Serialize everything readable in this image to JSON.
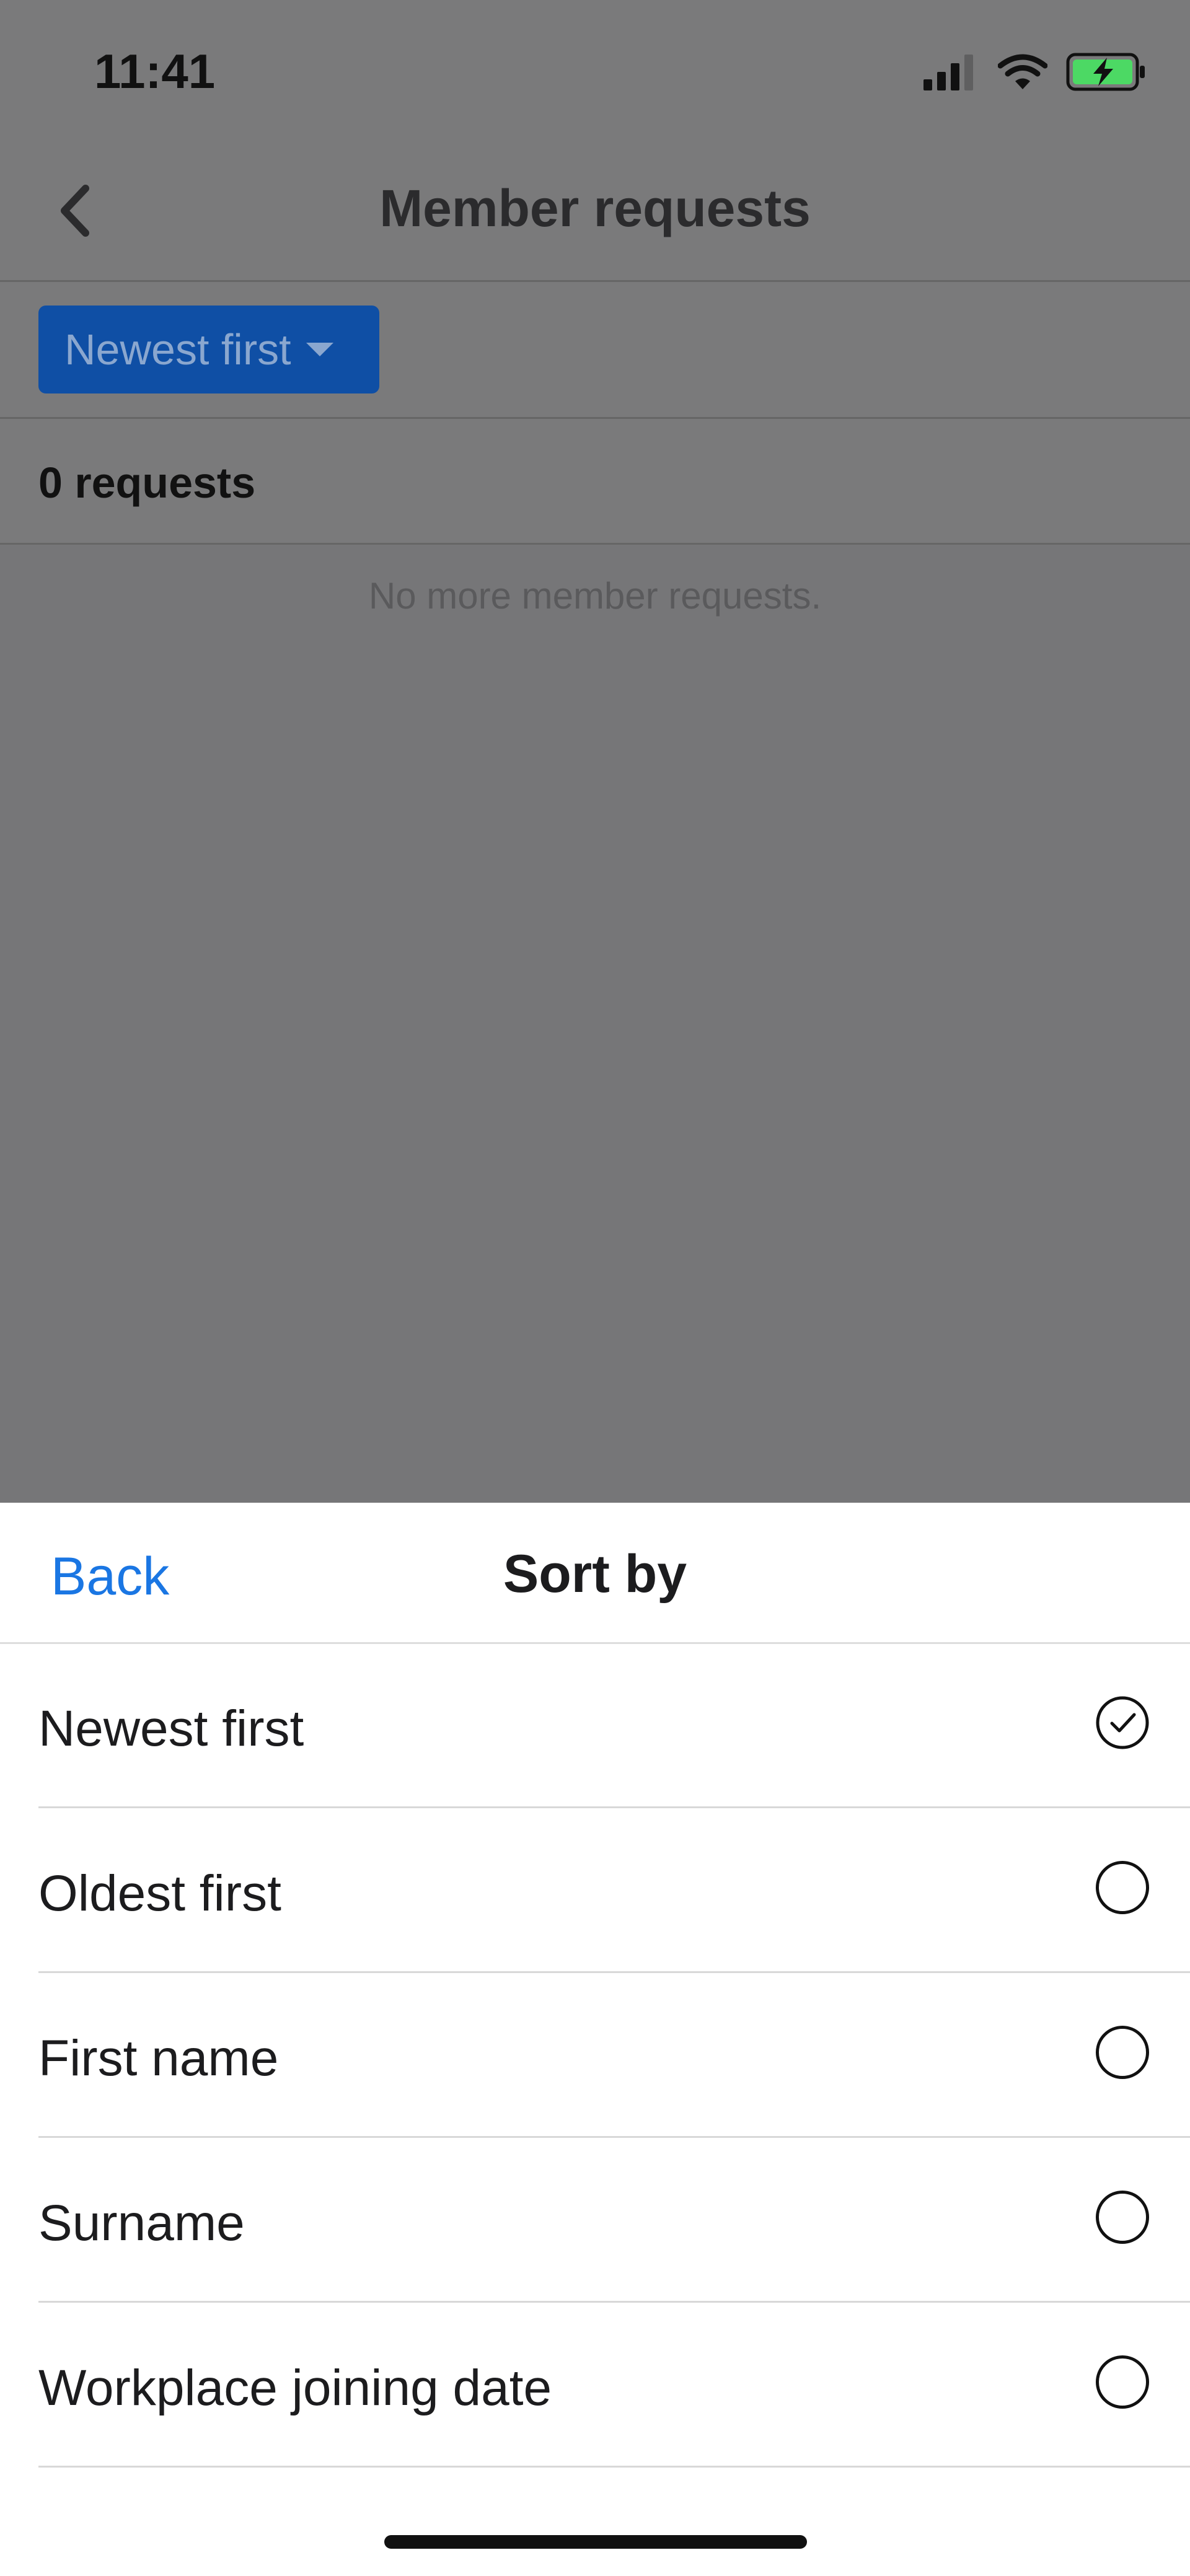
{
  "status_bar": {
    "time": "11:41"
  },
  "nav": {
    "title": "Member requests"
  },
  "filter": {
    "sort_label": "Newest first"
  },
  "list": {
    "count_text": "0 requests",
    "empty_text": "No more member requests."
  },
  "sheet": {
    "back_label": "Back",
    "title": "Sort by",
    "options": [
      {
        "label": "Newest first",
        "selected": true
      },
      {
        "label": "Oldest first",
        "selected": false
      },
      {
        "label": "First name",
        "selected": false
      },
      {
        "label": "Surname",
        "selected": false
      },
      {
        "label": "Workplace joining date",
        "selected": false
      }
    ]
  },
  "colors": {
    "accent": "#1a76e3",
    "sort_button_bg": "#0f4fa5",
    "battery_green": "#4cd964",
    "overlay": "#767678"
  }
}
